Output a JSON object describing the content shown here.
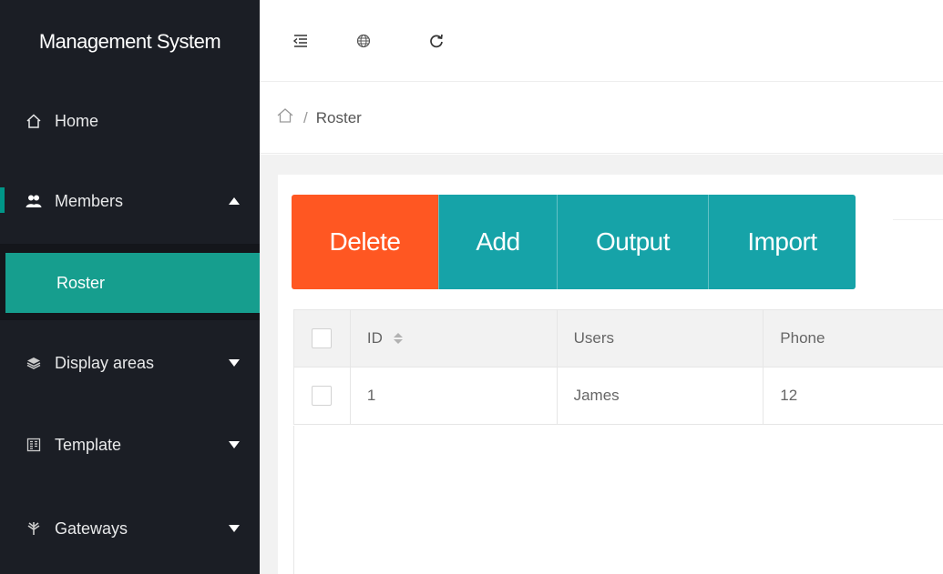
{
  "app": {
    "title": "Management System"
  },
  "sidebar": {
    "items": [
      {
        "label": "Home",
        "icon": "home-icon"
      },
      {
        "label": "Members",
        "icon": "users-icon",
        "expanded": true
      },
      {
        "label": "Display areas",
        "icon": "layers-icon"
      },
      {
        "label": "Template",
        "icon": "template-icon"
      },
      {
        "label": "Gateways",
        "icon": "gateway-icon"
      }
    ],
    "submenu": {
      "label": "Roster"
    }
  },
  "topbar": {
    "icons": [
      "menu-fold-icon",
      "globe-icon",
      "refresh-icon"
    ]
  },
  "breadcrumb": {
    "separator": "/",
    "current": "Roster"
  },
  "toolbar": {
    "delete_label": "Delete",
    "add_label": "Add",
    "output_label": "Output",
    "import_label": "Import"
  },
  "table": {
    "columns": [
      "ID",
      "Users",
      "Phone"
    ],
    "rows": [
      {
        "id": "1",
        "user": "James",
        "phone": "12"
      }
    ]
  },
  "colors": {
    "sidebar": "#1b1e25",
    "accent": "#169e8e",
    "danger": "#ff5722",
    "primary_btn": "#16a3a8"
  }
}
